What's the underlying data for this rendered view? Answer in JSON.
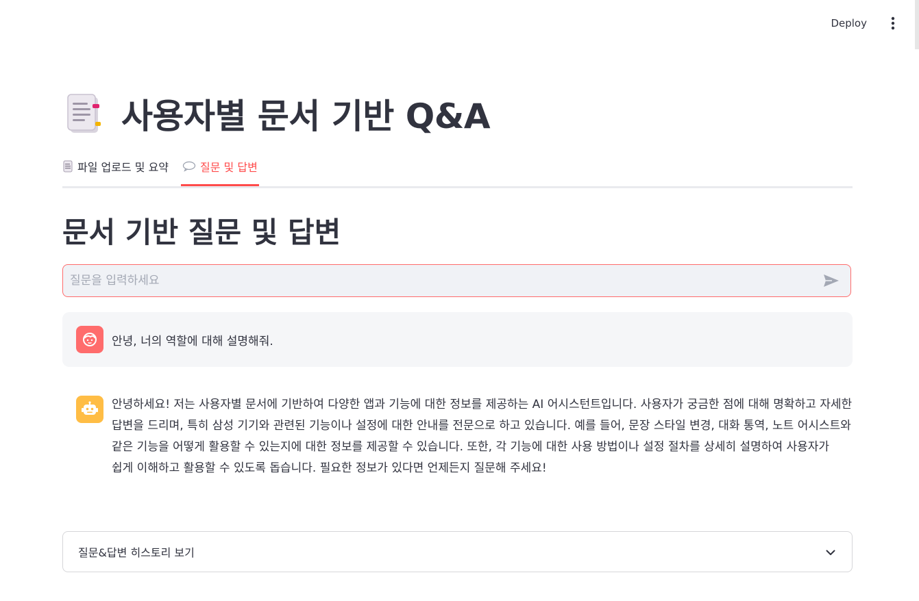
{
  "toolbar": {
    "deploy_label": "Deploy",
    "menu_icon": "more-vertical-icon"
  },
  "header": {
    "title": "사용자별 문서 기반 Q&A",
    "title_icon": "document-icon"
  },
  "tabs": [
    {
      "label": "파일 업로드 및 요약",
      "icon": "document-icon",
      "active": false
    },
    {
      "label": "질문 및 답변",
      "icon": "speech-bubble-icon",
      "active": true
    }
  ],
  "section": {
    "title": "문서 기반 질문 및 답변"
  },
  "chat_input": {
    "value": "",
    "placeholder": "질문을 입력하세요",
    "send_icon": "send-icon"
  },
  "messages": [
    {
      "role": "user",
      "avatar_icon": "user-face-icon",
      "text": "안녕, 너의 역할에 대해 설명해줘."
    },
    {
      "role": "assistant",
      "avatar_icon": "robot-icon",
      "text": "안녕하세요! 저는 사용자별 문서에 기반하여 다양한 앱과 기능에 대한 정보를 제공하는 AI 어시스턴트입니다. 사용자가 궁금한 점에 대해 명확하고 자세한 답변을 드리며, 특히 삼성 기기와 관련된 기능이나 설정에 대한 안내를 전문으로 하고 있습니다. 예를 들어, 문장 스타일 변경, 대화 통역, 노트 어시스트와 같은 기능을 어떻게 활용할 수 있는지에 대한 정보를 제공할 수 있습니다. 또한, 각 기능에 대한 사용 방법이나 설정 절차를 상세히 설명하여 사용자가 쉽게 이해하고 활용할 수 있도록 돕습니다. 필요한 정보가 있다면 언제든지 질문해 주세요!"
    }
  ],
  "expander": {
    "label": "질문&답변 히스토리 보기",
    "icon": "chevron-down-icon"
  },
  "colors": {
    "accent": "#ff4b4b",
    "user_avatar": "#ff6c6c",
    "bot_avatar": "#ffbd45",
    "text": "#31333f",
    "input_bg": "#f0f2f6"
  }
}
